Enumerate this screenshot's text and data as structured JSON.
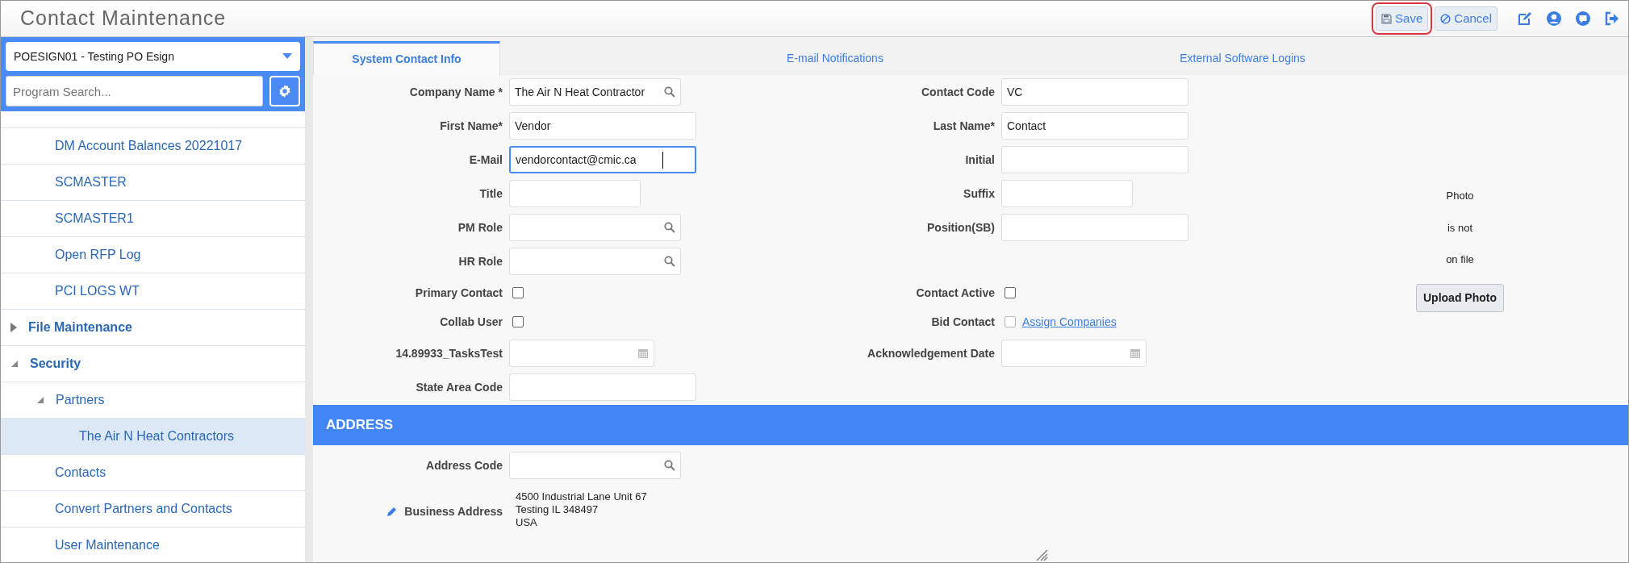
{
  "header": {
    "title": "Contact Maintenance",
    "buttons": [
      {
        "label": "Save",
        "kind": "save",
        "highlighted": true
      },
      {
        "label": "Cancel",
        "kind": "cancel",
        "highlighted": false
      }
    ]
  },
  "sidebar": {
    "company": "POESIGN01 - Testing PO Esign",
    "search": {
      "placeholder": "Program Search..."
    },
    "items": [
      {
        "label": "DM Account Balances 20221017",
        "kind": "program",
        "selected": false
      },
      {
        "label": "SCMASTER",
        "kind": "program",
        "selected": false
      },
      {
        "label": "SCMASTER1",
        "kind": "program",
        "selected": false
      },
      {
        "label": "Open RFP Log",
        "kind": "program",
        "selected": false
      },
      {
        "label": "PCI LOGS WT",
        "kind": "program",
        "selected": false
      },
      {
        "label": "File Maintenance",
        "kind": "folder",
        "expanded": false,
        "selected": false
      },
      {
        "label": "Security",
        "kind": "folder",
        "expanded": true,
        "selected": false,
        "children": [
          {
            "label": "Partners",
            "kind": "folder",
            "expanded": true,
            "selected": false,
            "children": [
              {
                "label": "The Air N Heat Contractors",
                "kind": "program",
                "selected": true
              }
            ]
          },
          {
            "label": "Contacts",
            "kind": "program",
            "selected": false
          },
          {
            "label": "Convert Partners and Contacts",
            "kind": "program",
            "selected": false
          },
          {
            "label": "User Maintenance",
            "kind": "program",
            "selected": false
          }
        ]
      }
    ]
  },
  "tabs": [
    {
      "label": "System Contact Info",
      "selected": true
    },
    {
      "label": "E-mail Notifications",
      "selected": false
    },
    {
      "label": "External Software Logins",
      "selected": false
    }
  ],
  "form_rows": [
    {
      "left": {
        "label": "Company Name *",
        "kind": "lookup",
        "value": "The Air N Heat Contractor",
        "focused": false
      },
      "right": {
        "label": "Contact Code",
        "kind": "text",
        "value": "VC",
        "focused": false
      }
    },
    {
      "left": {
        "label": "First Name*",
        "kind": "text",
        "value": "Vendor",
        "focused": false
      },
      "right": {
        "label": "Last Name*",
        "kind": "text",
        "value": "Contact",
        "focused": false
      }
    },
    {
      "left": {
        "label": "E-Mail",
        "kind": "text",
        "value": "vendorcontact@cmic.ca",
        "focused": true
      },
      "right": {
        "label": "Initial",
        "kind": "text",
        "focused": false
      }
    },
    {
      "left": {
        "label": "Title",
        "kind": "short",
        "focused": false
      },
      "right": {
        "label": "Suffix",
        "kind": "short",
        "focused": false
      }
    },
    {
      "left": {
        "label": "PM Role",
        "kind": "lookup",
        "focused": false
      },
      "right": {
        "label": "Position(SB)",
        "kind": "text",
        "focused": false
      }
    },
    {
      "left": {
        "label": "HR Role",
        "kind": "lookup",
        "focused": false
      }
    },
    {
      "left": {
        "label": "Primary Contact",
        "kind": "checkbox",
        "checked": false,
        "disabled": false
      },
      "right": {
        "label": "Contact Active",
        "kind": "checkbox",
        "checked": false,
        "disabled": false
      }
    },
    {
      "left": {
        "label": "Collab User",
        "kind": "checkbox",
        "checked": false,
        "disabled": false
      },
      "right": {
        "label": "Bid Contact",
        "kind": "checkbox",
        "checked": false,
        "disabled": true,
        "link": "Assign Companies"
      }
    },
    {
      "left": {
        "label": "14.89933_TasksTest",
        "kind": "date",
        "focused": false
      },
      "right": {
        "label": "Acknowledgement Date",
        "kind": "date",
        "focused": false
      }
    },
    {
      "left": {
        "label": "State Area Code",
        "kind": "text",
        "focused": false
      }
    }
  ],
  "photo": {
    "message_lines": [
      "Photo",
      "is not",
      "on file"
    ],
    "button": "Upload Photo"
  },
  "address": {
    "title": "ADDRESS",
    "code": {
      "label": "Address Code",
      "kind": "lookup",
      "focused": false
    },
    "business": {
      "label": "Business Address",
      "lines": [
        "4500 Industrial Lane Unit 67",
        "Testing IL 348497",
        "USA"
      ]
    }
  }
}
